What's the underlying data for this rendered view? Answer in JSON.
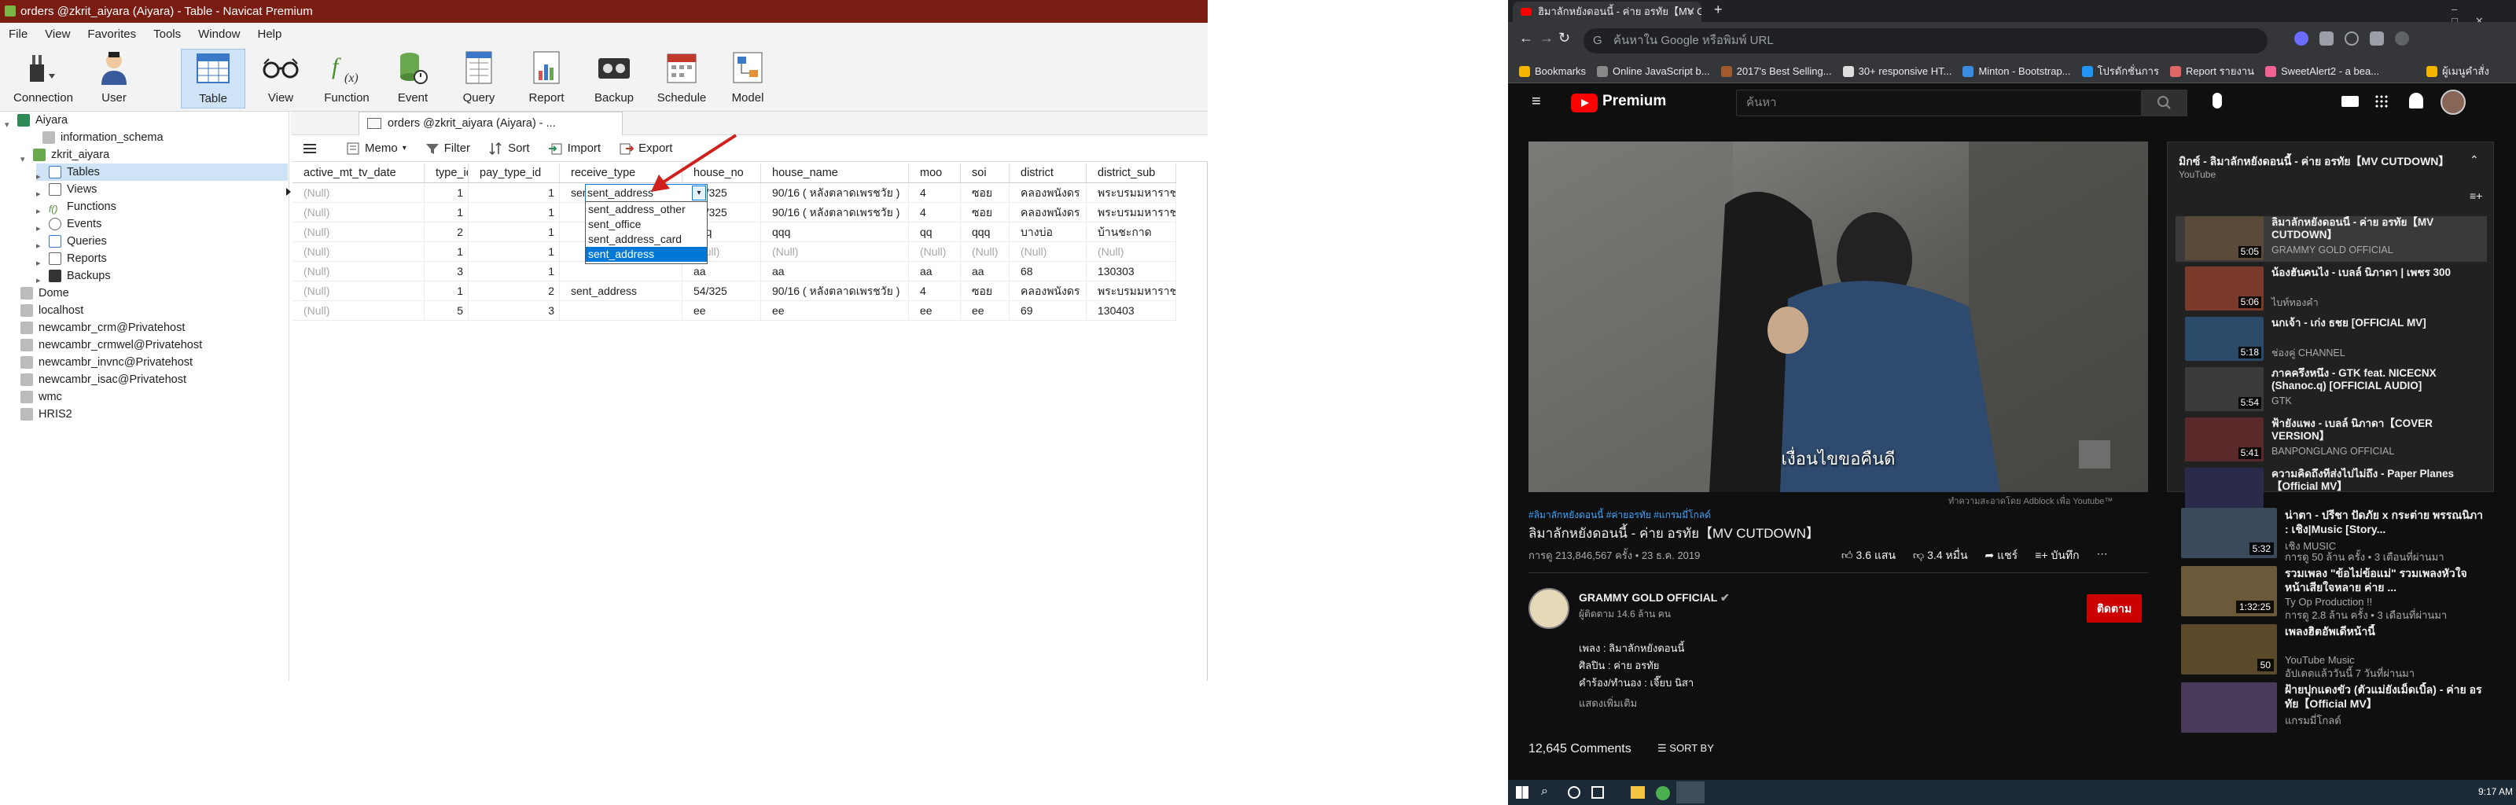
{
  "navicat": {
    "title": "orders @zkrit_aiyara (Aiyara) - Table - Navicat Premium",
    "menu": [
      "File",
      "View",
      "Favorites",
      "Tools",
      "Window",
      "Help"
    ],
    "toolbar": {
      "connection": "Connection",
      "user": "User",
      "table": "Table",
      "view": "View",
      "function": "Function",
      "event": "Event",
      "query": "Query",
      "report": "Report",
      "backup": "Backup",
      "schedule": "Schedule",
      "model": "Model"
    },
    "tree": {
      "aiyara": "Aiyara",
      "information_schema": "information_schema",
      "zkrit_aiyara": "zkrit_aiyara",
      "tables": "Tables",
      "views": "Views",
      "functions": "Functions",
      "events": "Events",
      "queries": "Queries",
      "reports": "Reports",
      "backups": "Backups",
      "dome": "Dome",
      "localhost": "localhost",
      "c1": "newcambr_crm@Privatehost",
      "c2": "newcambr_crmwel@Privatehost",
      "c3": "newcambr_invnc@Privatehost",
      "c4": "newcambr_isac@Privatehost",
      "wmc": "wmc",
      "hris2": "HRIS2"
    },
    "tab": "orders @zkrit_aiyara (Aiyara) - ...",
    "subtoolbar": {
      "memo": "Memo",
      "filter": "Filter",
      "sort": "Sort",
      "import": "Import",
      "export": "Export"
    },
    "columns": [
      "active_mt_tv_date",
      "type_id",
      "pay_type_id",
      "receive_type",
      "house_no",
      "house_name",
      "moo",
      "soi",
      "district",
      "district_sub"
    ],
    "rows": [
      [
        "(Null)",
        "1",
        "1",
        "sent_address",
        "54/325",
        "90/16 ( หลังตลาดเพรชวัย )",
        "4",
        "ซอย",
        "คลองพนังดร",
        "พระบรมมหาราชวัง"
      ],
      [
        "(Null)",
        "1",
        "1",
        "",
        "54/325",
        "90/16 ( หลังตลาดเพรชวัย )",
        "4",
        "ซอย",
        "คลองพนังดร",
        "พระบรมมหาราชวัง"
      ],
      [
        "(Null)",
        "2",
        "1",
        "",
        "qqq",
        "qqq",
        "qq",
        "qqq",
        "บางบ่อ",
        "บ้านชะกาด"
      ],
      [
        "(Null)",
        "1",
        "1",
        "",
        "(Null)",
        "(Null)",
        "(Null)",
        "(Null)",
        "(Null)",
        "(Null)"
      ],
      [
        "(Null)",
        "3",
        "1",
        "",
        "aa",
        "aa",
        "aa",
        "aa",
        "68",
        "130303"
      ],
      [
        "(Null)",
        "1",
        "2",
        "sent_address",
        "54/325",
        "90/16 ( หลังตลาดเพรชวัย )",
        "4",
        "ซอย",
        "คลองพนังดร",
        "พระบรมมหาราชวัง"
      ],
      [
        "(Null)",
        "5",
        "3",
        "",
        "ee",
        "ee",
        "ee",
        "ee",
        "69",
        "130403"
      ]
    ],
    "dropdown": [
      "sent_address_other",
      "sent_office",
      "sent_address_card",
      "sent_address"
    ],
    "dropdown_selected": "sent_address"
  },
  "chrome": {
    "tab_title": "ฮิมาลักหยังดอนนี้ - ค่าย อรทัย【MV CUTDOWN】",
    "omnibox": "ค้นหาใน Google หรือพิมพ์ URL",
    "bookmarks": [
      "Bookmarks",
      "Online JavaScript b...",
      "2017's Best Selling...",
      "30+ responsive HT...",
      "Minton - Bootstrap...",
      "โปรดักชั่นการ",
      "Report รายงาน",
      "SweetAlert2 - a bea...",
      "ผู้เมนูคำสั่ง"
    ],
    "yt": {
      "logo": "Premium",
      "search_placeholder": "ค้นหา",
      "hashtags": "#ลิมาลักหยังดอนนี้ #ค่ายอรทัย #แกรมมี่โกลด์",
      "video_title": "ลิมาลักหยังดอนนี้ - ค่าย อรทัย【MV CUTDOWN】",
      "views": "การดู 213,846,567 ครั้ง • 23 ธ.ค. 2019",
      "likes": "3.6 แสน",
      "dislikes": "3.4 หมื่น",
      "share": "แชร์",
      "save": "บันทึก",
      "channel": "GRAMMY GOLD OFFICIAL",
      "subs": "ผู้ติดตาม 14.6 ล้าน คน",
      "subscribe": "ติดตาม",
      "desc": [
        "เพลง : ลิมาลักหยังดอนนี้",
        "ศิลปิน : ค่าย อรทัย",
        "คำร้อง/ทำนอง : เจี๊ยบ นิสา"
      ],
      "show_more": "แสดงเพิ่มเติม",
      "comments": "12,645 Comments",
      "sort_by": "SORT BY",
      "subtitle": "เงื่อนไขขอคืนดี",
      "credit": "ทำความสะอาดโดย Adblock เพื่อ Youtube™",
      "playlist_title": "มิกซ์ - ลิมาลักหยังดอนนี้ - ค่าย อรทัย【MV CUTDOWN】",
      "playlist_sub": "YouTube",
      "playlist": [
        {
          "t": "ลิมาลักหยังดอนนี้ - ค่าย อรทัย【MV CUTDOWN】",
          "c": "GRAMMY GOLD OFFICIAL",
          "d": "5:05"
        },
        {
          "t": "น้องฮันคนไง - เบลล์ นิภาดา | เพชร 300",
          "c": "ไบท์ทองคำ",
          "d": "5:06"
        },
        {
          "t": "นกเจ้า - เก่ง ธชย [OFFICIAL MV]",
          "c": "ช่องคู่ CHANNEL",
          "d": "5:18"
        },
        {
          "t": "ภาคครึ่งหนึ่ง - GTK feat. NICECNX (Shanoc.q) [OFFICIAL AUDIO]",
          "c": "GTK",
          "d": "5:54"
        },
        {
          "t": "ฟ้ายังแพง - เบลล์ นิภาดา【COVER VERSION】",
          "c": "BANPONGLANG OFFICIAL",
          "d": "5:41"
        },
        {
          "t": "ความคิดถึงที่ส่งไปไม่ถึง - Paper Planes【Official MV】",
          "c": "",
          "d": ""
        }
      ],
      "suggestions": [
        {
          "t": "น่าตา - ปรีชา ปัดภัย x กระต่าย พรรณนิภา : เชิง|Music [Story...",
          "c": "เชิง MUSIC",
          "c2": "การดู 50 ล้าน ครั้ง • 3 เดือนที่ผ่านมา",
          "d": "5:32"
        },
        {
          "t": "รวมเพลง \"ข้อไม่ข้อแม่\" รวมเพลงหัวใจหน้าเสียใจหลาย ค่าย ...",
          "c": "Ty Op Production !!",
          "c2": "การดู 2.8 ล้าน ครั้ง • 3 เดือนที่ผ่านมา",
          "d": "1:32:25"
        },
        {
          "t": "เพลงฮิตอัพเดีหน้านี้",
          "c": "YouTube Music",
          "c2": "อัปเดตแล้ววันนี้ 7 วันที่ผ่านมา",
          "d": "50"
        },
        {
          "t": "ฝ้ายปุกแดงขัว (ตัวแม่ยังเม็ดเบิ้ล) - ค่าย อรทัย【Official MV】",
          "c": "แกรมมี่โกลด์",
          "c2": "",
          "d": ""
        }
      ]
    },
    "clock": "9:17 AM"
  }
}
